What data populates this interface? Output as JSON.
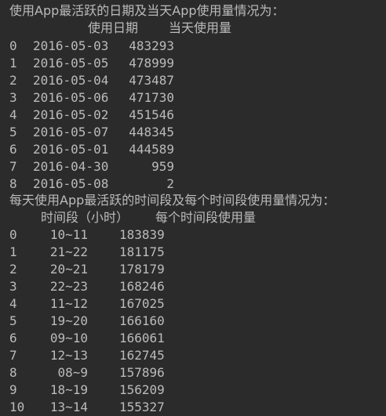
{
  "section1": {
    "heading": "使用App最活跃的日期及当天App使用量情况为：",
    "columns": [
      "使用日期",
      "当天使用量"
    ],
    "rows": [
      {
        "index": "0",
        "date": "2016-05-03",
        "count": "483293"
      },
      {
        "index": "1",
        "date": "2016-05-05",
        "count": "478999"
      },
      {
        "index": "2",
        "date": "2016-05-04",
        "count": "473487"
      },
      {
        "index": "3",
        "date": "2016-05-06",
        "count": "471730"
      },
      {
        "index": "4",
        "date": "2016-05-02",
        "count": "451546"
      },
      {
        "index": "5",
        "date": "2016-05-07",
        "count": "448345"
      },
      {
        "index": "6",
        "date": "2016-05-01",
        "count": "444589"
      },
      {
        "index": "7",
        "date": "2016-04-30",
        "count": "959"
      },
      {
        "index": "8",
        "date": "2016-05-08",
        "count": "2"
      }
    ]
  },
  "section2": {
    "heading": "每天使用App最活跃的时间段及每个时间段使用量情况为：",
    "columns": [
      "时间段（小时）",
      "每个时间段使用量"
    ],
    "rows": [
      {
        "index": "0",
        "period": "10~11",
        "count": "183839"
      },
      {
        "index": "1",
        "period": "21~22",
        "count": "181175"
      },
      {
        "index": "2",
        "period": "20~21",
        "count": "178179"
      },
      {
        "index": "3",
        "period": "22~23",
        "count": "168246"
      },
      {
        "index": "4",
        "period": "11~12",
        "count": "167025"
      },
      {
        "index": "5",
        "period": "19~20",
        "count": "166160"
      },
      {
        "index": "6",
        "period": "09~10",
        "count": "166061"
      },
      {
        "index": "7",
        "period": "12~13",
        "count": "162745"
      },
      {
        "index": "8",
        "period": "08~9",
        "count": "157896"
      },
      {
        "index": "9",
        "period": "18~19",
        "count": "156209"
      },
      {
        "index": "10",
        "period": "13~14",
        "count": "155327"
      }
    ]
  }
}
